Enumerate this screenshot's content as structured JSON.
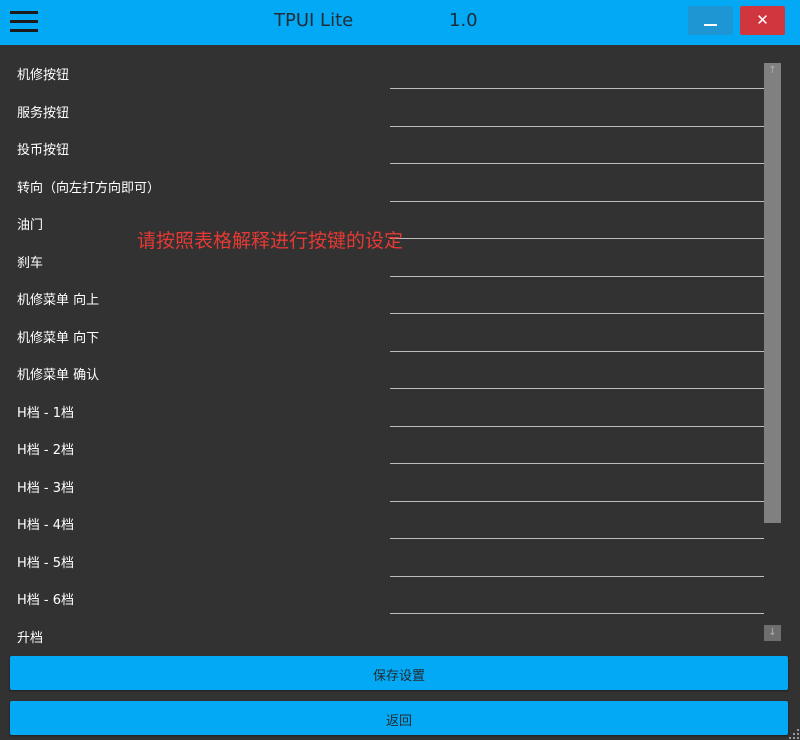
{
  "titlebar": {
    "menu_icon": "hamburger-menu-icon",
    "title": "TPUI Lite",
    "version": "1.0",
    "minimize_icon": "minimize-icon",
    "close_glyph": "✕",
    "colors": {
      "accent": "#03a9f4",
      "minimize": "#1e96d3",
      "close": "#d0363d"
    }
  },
  "hint": "请按照表格解释进行按键的设定",
  "rows": [
    {
      "label": "机修按钮",
      "value": ""
    },
    {
      "label": "服务按钮",
      "value": ""
    },
    {
      "label": "投币按钮",
      "value": ""
    },
    {
      "label": "转向（向左打方向即可）",
      "value": ""
    },
    {
      "label": "油门",
      "value": ""
    },
    {
      "label": "刹车",
      "value": ""
    },
    {
      "label": "机修菜单 向上",
      "value": ""
    },
    {
      "label": "机修菜单 向下",
      "value": ""
    },
    {
      "label": "机修菜单 确认",
      "value": ""
    },
    {
      "label": "H档 - 1档",
      "value": ""
    },
    {
      "label": "H档 - 2档",
      "value": ""
    },
    {
      "label": "H档 - 3档",
      "value": ""
    },
    {
      "label": "H档 - 4档",
      "value": ""
    },
    {
      "label": "H档 - 5档",
      "value": ""
    },
    {
      "label": "H档 - 6档",
      "value": ""
    },
    {
      "label": "升档",
      "value": ""
    }
  ],
  "scrollbar": {
    "up_arrow": "↑",
    "down_arrow": "↓"
  },
  "buttons": {
    "save": "保存设置",
    "back": "返回"
  }
}
